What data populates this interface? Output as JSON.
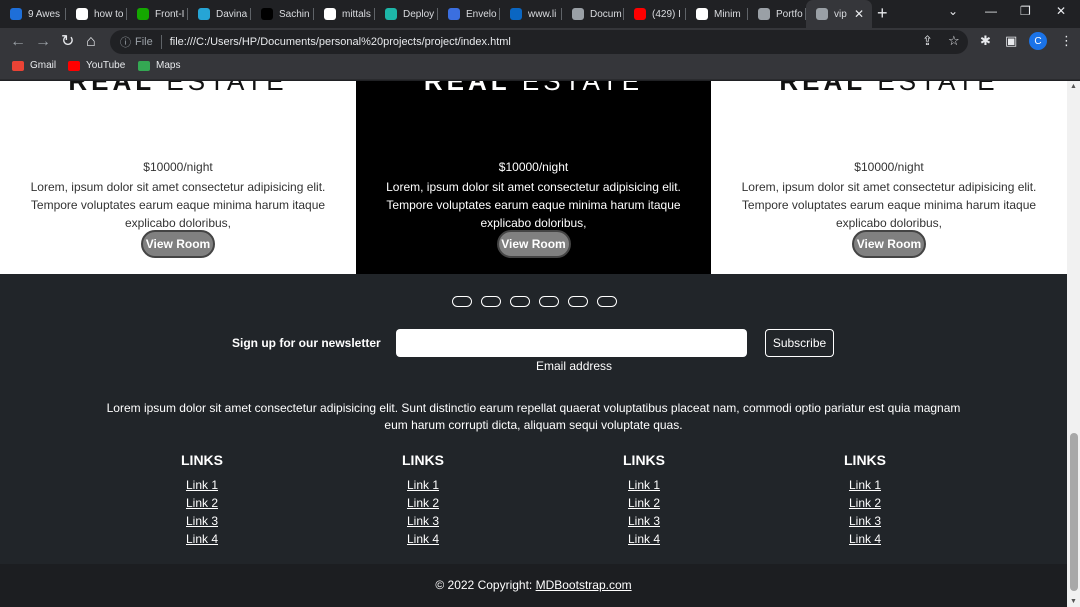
{
  "browser": {
    "tabs": [
      {
        "label": "9 Awes",
        "icon": "codepen-icon",
        "color": "#1e6fd9"
      },
      {
        "label": "how to",
        "icon": "google-icon",
        "color": "#ffffff"
      },
      {
        "label": "Front-I",
        "icon": "upwork-icon",
        "color": "#14a800"
      },
      {
        "label": "Davina",
        "icon": "app-icon",
        "color": "#26a5d6"
      },
      {
        "label": "Sachin",
        "icon": "app-icon",
        "color": "#000000"
      },
      {
        "label": "mittals",
        "icon": "github-icon",
        "color": "#ffffff"
      },
      {
        "label": "Deploy",
        "icon": "diamond-icon",
        "color": "#1db6a8"
      },
      {
        "label": "Envelo",
        "icon": "flag-icon",
        "color": "#3b6fe0"
      },
      {
        "label": "www.li",
        "icon": "linkedin-icon",
        "color": "#0a66c2"
      },
      {
        "label": "Docum",
        "icon": "globe-icon",
        "color": "#9aa0a6"
      },
      {
        "label": "(429) I",
        "icon": "youtube-icon",
        "color": "#ff0000"
      },
      {
        "label": "Minim",
        "icon": "app-icon",
        "color": "#ffffff"
      },
      {
        "label": "Portfo",
        "icon": "globe-icon",
        "color": "#9aa0a6"
      },
      {
        "label": "vip",
        "icon": "globe-icon",
        "color": "#9aa0a6"
      }
    ],
    "address": {
      "info": "ⓘ",
      "scheme_label": "File",
      "url": "file:///C:/Users/HP/Documents/personal%20projects/project/index.html"
    },
    "profile_initial": "C",
    "bookmarks": [
      {
        "label": "Gmail",
        "icon": "gmail-icon",
        "color": "#ea4335"
      },
      {
        "label": "YouTube",
        "icon": "youtube-icon",
        "color": "#ff0000"
      },
      {
        "label": "Maps",
        "icon": "maps-icon",
        "color": "#34a853"
      }
    ]
  },
  "page": {
    "cards": [
      {
        "logo_bold": "REAL",
        "logo_light": "ESTATE",
        "price": "$10000/night",
        "description": "Lorem, ipsum dolor sit amet consectetur adipisicing elit. Tempore voluptates earum eaque minima harum itaque explicabo doloribus,",
        "button": "View Room",
        "theme": "light"
      },
      {
        "logo_bold": "REAL",
        "logo_light": "ESTATE",
        "price": "$10000/night",
        "description": "Lorem, ipsum dolor sit amet consectetur adipisicing elit. Tempore voluptates earum eaque minima harum itaque explicabo doloribus,",
        "button": "View Room",
        "theme": "dark"
      },
      {
        "logo_bold": "REAL",
        "logo_light": "ESTATE",
        "price": "$10000/night",
        "description": "Lorem, ipsum dolor sit amet consectetur adipisicing elit. Tempore voluptates earum eaque minima harum itaque explicabo doloribus,",
        "button": "View Room",
        "theme": "light"
      }
    ],
    "footer": {
      "social_buttons": 6,
      "newsletter": {
        "label": "Sign up for our newsletter",
        "input_value": "",
        "hint": "Email address",
        "button": "Subscribe"
      },
      "blurb": "Lorem ipsum dolor sit amet consectetur adipisicing elit. Sunt distinctio earum repellat quaerat voluptatibus placeat nam, commodi optio pariatur est quia magnam eum harum corrupti dicta, aliquam sequi voluptate quas.",
      "link_columns": [
        {
          "heading": "LINKS",
          "links": [
            "Link 1",
            "Link 2",
            "Link 3",
            "Link 4"
          ]
        },
        {
          "heading": "LINKS",
          "links": [
            "Link 1",
            "Link 2",
            "Link 3",
            "Link 4"
          ]
        },
        {
          "heading": "LINKS",
          "links": [
            "Link 1",
            "Link 2",
            "Link 3",
            "Link 4"
          ]
        },
        {
          "heading": "LINKS",
          "links": [
            "Link 1",
            "Link 2",
            "Link 3",
            "Link 4"
          ]
        }
      ],
      "copyright_prefix": "© 2022 Copyright: ",
      "copyright_link": "MDBootstrap.com"
    }
  }
}
